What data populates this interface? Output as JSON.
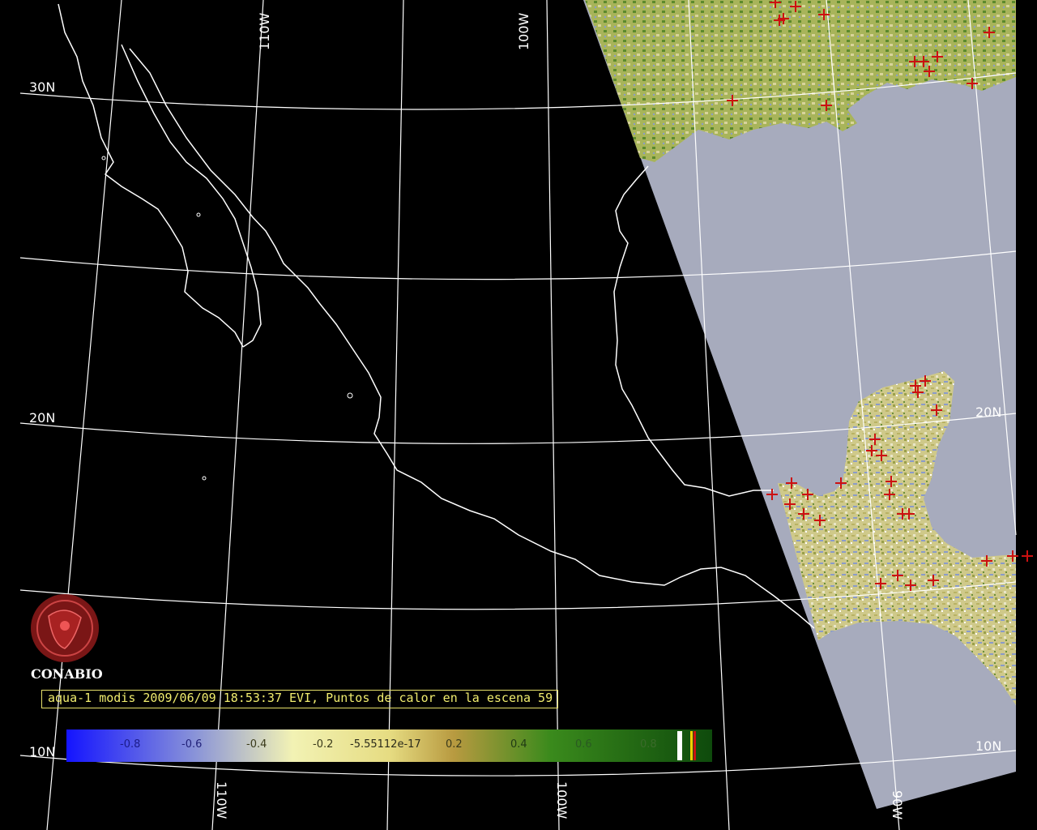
{
  "map": {
    "longitude_labels_top": [
      "110W",
      "100W"
    ],
    "longitude_labels_bottom": [
      "110W",
      "100W",
      "90W"
    ],
    "latitude_labels_left": [
      "30N",
      "20N",
      "10N"
    ],
    "latitude_labels_right": [
      "20N",
      "10N"
    ],
    "fire_marker_color": "#cc1111",
    "land_overlay_color": "#a7abbd",
    "coastline_color": "#ffffff",
    "grid_color": "#ffffff"
  },
  "logo": {
    "name": "CONABIO",
    "color": "#8b1a1a"
  },
  "caption": "aqua-1 modis 2009/06/09 18:53:37 EVI, Puntos de calor en la escena 59",
  "colorbar": {
    "ticks": [
      "-0.8",
      "-0.6",
      "-0.4",
      "-0.2",
      "-5.55112e-17",
      "0.2",
      "0.4",
      "0.6",
      "0.8"
    ]
  }
}
